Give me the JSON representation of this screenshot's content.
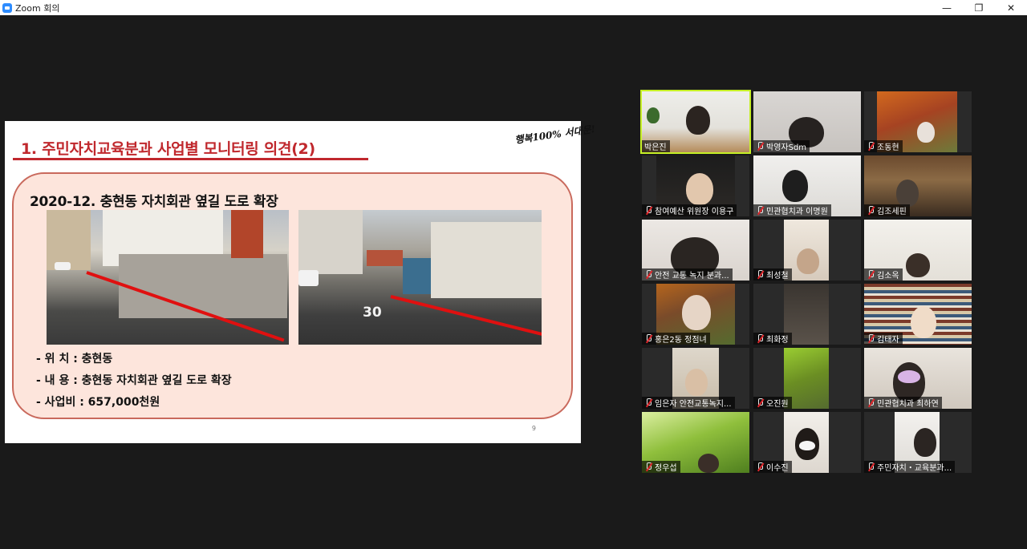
{
  "window": {
    "title": "Zoom 회의",
    "controls": {
      "minimize": "—",
      "restore": "❐",
      "close": "✕"
    }
  },
  "slide": {
    "title": "1. 주민자치교육분과 사업별 모니터링 의견(2)",
    "logo_text": "행복100% 서대문!",
    "heading": "2020-12. 충현동 자치회관 옆길 도로 확장",
    "info": [
      "- 위   치 : 충현동",
      "- 내   용 : 충현동 자치회관 옆길 도로 확장",
      "- 사업비 : 657,000천원"
    ],
    "page_number": "9",
    "photo2_road_mark": "30"
  },
  "participants": [
    {
      "name": "박은진",
      "muted": false,
      "active": true
    },
    {
      "name": "박영자Sdm",
      "muted": true,
      "active": false
    },
    {
      "name": "조동현",
      "muted": true,
      "active": false
    },
    {
      "name": "참여예산 위원장 이용구",
      "muted": true,
      "active": false
    },
    {
      "name": "민관협치과 이명원",
      "muted": true,
      "active": false
    },
    {
      "name": "김조세핀",
      "muted": true,
      "active": false
    },
    {
      "name": "안전 교통 녹지 분과...",
      "muted": true,
      "active": false
    },
    {
      "name": "최성철",
      "muted": true,
      "active": false
    },
    {
      "name": "김소옥",
      "muted": true,
      "active": false
    },
    {
      "name": "홍은2동 정점녀",
      "muted": true,
      "active": false
    },
    {
      "name": "최화정",
      "muted": true,
      "active": false
    },
    {
      "name": "김태자",
      "muted": true,
      "active": false
    },
    {
      "name": "임은자 안전교통녹지...",
      "muted": true,
      "active": false
    },
    {
      "name": "오진원",
      "muted": true,
      "active": false
    },
    {
      "name": "민관협치과 최하연",
      "muted": true,
      "active": false
    },
    {
      "name": "정우섭",
      "muted": true,
      "active": false
    },
    {
      "name": "이수진",
      "muted": true,
      "active": false
    },
    {
      "name": "주민자치・교육분과...",
      "muted": true,
      "active": false
    }
  ],
  "colors": {
    "accent_active": "#c6f026",
    "slide_title": "#c0282d",
    "card_bg": "#fde5dc",
    "muted_icon": "#e0262b"
  }
}
